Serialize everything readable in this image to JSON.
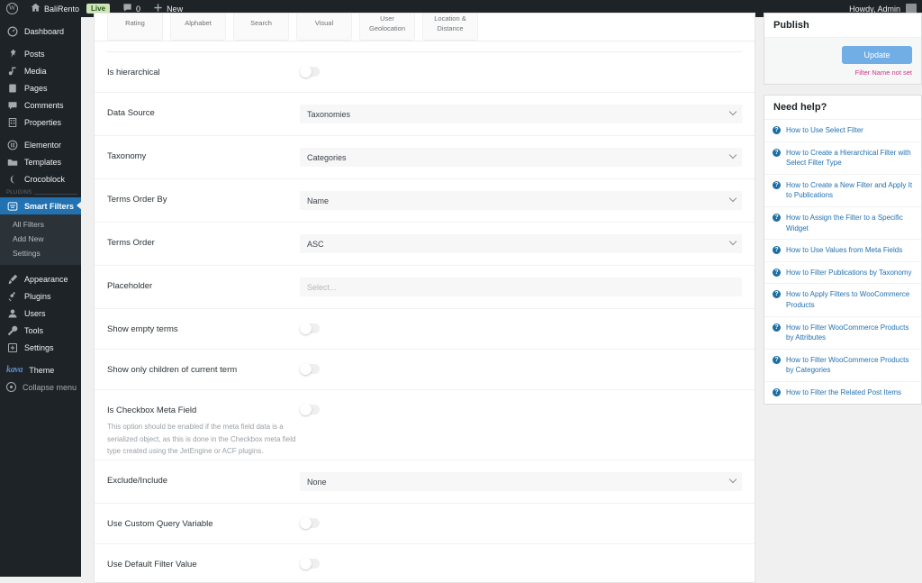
{
  "adminbar": {
    "logo_icon": "wordpress-logo-icon",
    "site_icon": "home-icon",
    "site_name": "BaliRento",
    "live_badge": "Live",
    "comments_icon": "comment-bubble-icon",
    "comments_count": "0",
    "new_icon": "plus-icon",
    "new_label": "New",
    "howdy": "Howdy, Admin",
    "avatar": "user-avatar"
  },
  "sidebar": {
    "items": [
      {
        "label": "Dashboard",
        "icon": "dashboard-icon"
      },
      {
        "label": "Posts",
        "icon": "pin-icon"
      },
      {
        "label": "Media",
        "icon": "media-icon"
      },
      {
        "label": "Pages",
        "icon": "page-icon"
      },
      {
        "label": "Comments",
        "icon": "comment-bubble-icon"
      },
      {
        "label": "Properties",
        "icon": "building-icon"
      },
      {
        "label": "Elementor",
        "icon": "elementor-icon"
      },
      {
        "label": "Templates",
        "icon": "folder-icon"
      },
      {
        "label": "Crocoblock",
        "icon": "crocoblock-icon"
      }
    ],
    "plugins_group_label": "PLUGINS",
    "current": {
      "label": "Smart Filters",
      "icon": "smart-filters-icon"
    },
    "submenu": [
      {
        "label": "All Filters"
      },
      {
        "label": "Add New"
      },
      {
        "label": "Settings"
      }
    ],
    "items_bottom": [
      {
        "label": "Appearance",
        "icon": "brush-icon"
      },
      {
        "label": "Plugins",
        "icon": "plug-icon"
      },
      {
        "label": "Users",
        "icon": "users-icon"
      },
      {
        "label": "Tools",
        "icon": "tools-icon"
      },
      {
        "label": "Settings",
        "icon": "settings-icon"
      }
    ],
    "theme": {
      "logo_text": "kava",
      "label": "Theme"
    },
    "collapse": {
      "label": "Collapse menu",
      "icon": "collapse-icon"
    }
  },
  "tabs": [
    {
      "label": "Rating"
    },
    {
      "label": "Alphabet"
    },
    {
      "label": "Search"
    },
    {
      "label": "Visual"
    },
    {
      "label": "User Geolocation"
    },
    {
      "label": "Location & Distance"
    }
  ],
  "fields": [
    {
      "label": "Is hierarchical",
      "type": "toggle",
      "value": "off"
    },
    {
      "label": "Data Source",
      "type": "select",
      "value": "Taxonomies"
    },
    {
      "label": "Taxonomy",
      "type": "select",
      "value": "Categories"
    },
    {
      "label": "Terms Order By",
      "type": "select",
      "value": "Name"
    },
    {
      "label": "Terms Order",
      "type": "select",
      "value": "ASC"
    },
    {
      "label": "Placeholder",
      "type": "text",
      "value": "",
      "placeholder": "Select..."
    },
    {
      "label": "Show empty terms",
      "type": "toggle",
      "value": "off"
    },
    {
      "label": "Show only children of current term",
      "type": "toggle",
      "value": "off"
    },
    {
      "label": "Is Checkbox Meta Field",
      "type": "toggle",
      "value": "off",
      "desc": "This option should be enabled if the meta field data is a serialized object, as this is done in the Checkbox meta field type created using the JetEngine or ACF plugins."
    },
    {
      "label": "Exclude/Include",
      "type": "select",
      "value": "None"
    },
    {
      "label": "Use Custom Query Variable",
      "type": "toggle",
      "value": "off"
    },
    {
      "label": "Use Default Filter Value",
      "type": "toggle",
      "value": "off"
    }
  ],
  "publish": {
    "title": "Publish",
    "update_label": "Update",
    "warning": "Filter Name not set",
    "accent_color": "#72aee6",
    "warning_color": "#d63384"
  },
  "help": {
    "title": "Need help?",
    "icon": "question-circle-icon",
    "link_color": "#2271b1",
    "links": [
      "How to Use Select Filter",
      "How to Create a Hierarchical Filter with Select Filter Type",
      "How to Create a New Filter and Apply It to Publications",
      "How to Assign the Filter to a Specific Widget",
      "How to Use Values from Meta Fields",
      "How to Filter Publications by Taxonomy",
      "How to Apply Filters to WooCommerce Products",
      "How to Filter WooCommerce Products by Attributes",
      "How to Filter WooCommerce Products by Categories",
      "How to Filter the Related Post Items"
    ]
  }
}
